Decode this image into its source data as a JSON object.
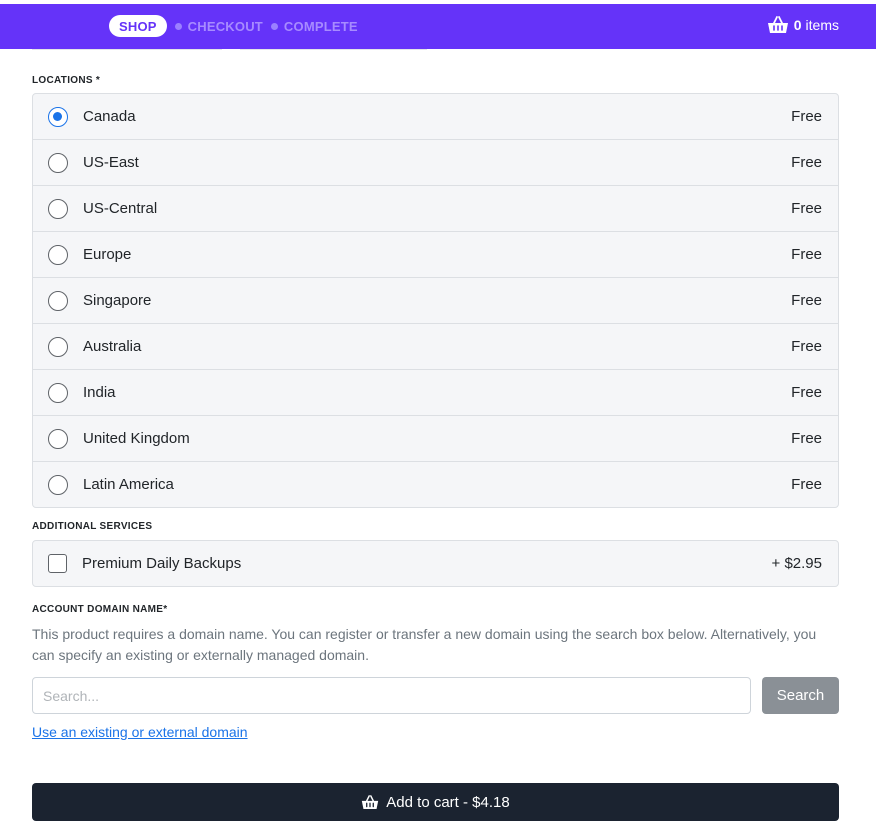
{
  "steps": {
    "active": "SHOP",
    "next": [
      "CHECKOUT",
      "COMPLETE"
    ]
  },
  "cart": {
    "count": "0",
    "label": "items",
    "icon": "basket-icon"
  },
  "locations": {
    "label": "LOCATIONS *",
    "selected": "Canada",
    "options": [
      {
        "name": "Canada",
        "price": "Free"
      },
      {
        "name": "US-East",
        "price": "Free"
      },
      {
        "name": "US-Central",
        "price": "Free"
      },
      {
        "name": "Europe",
        "price": "Free"
      },
      {
        "name": "Singapore",
        "price": "Free"
      },
      {
        "name": "Australia",
        "price": "Free"
      },
      {
        "name": "India",
        "price": "Free"
      },
      {
        "name": "United Kingdom",
        "price": "Free"
      },
      {
        "name": "Latin America",
        "price": "Free"
      }
    ]
  },
  "services": {
    "label": "ADDITIONAL SERVICES",
    "items": [
      {
        "name": "Premium Daily Backups",
        "price": "+ $2.95",
        "checked": false
      }
    ]
  },
  "domain": {
    "label": "ACCOUNT DOMAIN NAME*",
    "description": "This product requires a domain name. You can register or transfer a new domain using the search box below. Alternatively, you can specify an existing or externally managed domain.",
    "search_placeholder": "Search...",
    "search_value": "",
    "search_button": "Search",
    "external_link": "Use an existing or external domain"
  },
  "add_to_cart": {
    "label": "Add to cart - $4.18",
    "icon": "basket-icon"
  },
  "colors": {
    "brand": "#6533f9",
    "accent": "#1a73e8",
    "cart_button": "#1b2330"
  }
}
